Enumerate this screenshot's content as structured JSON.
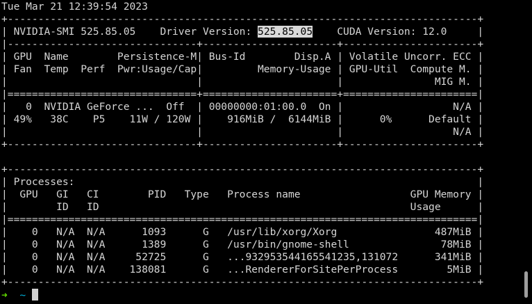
{
  "timestamp": "Tue Mar 21 12:39:54 2023",
  "header": {
    "border_top": "+-----------------------------------------------------------------------------+",
    "smi_version_text": "| NVIDIA-SMI 525.85.05    Driver Version: ",
    "driver_version": "525.85.05",
    "cuda_text": "    CUDA Version: 12.0     |",
    "border_mid": "|-------------------------------+----------------------+----------------------+",
    "col_row1": "| GPU  Name        Persistence-M| Bus-Id        Disp.A | Volatile Uncorr. ECC |",
    "col_row2": "| Fan  Temp  Perf  Pwr:Usage/Cap|         Memory-Usage | GPU-Util  Compute M. |",
    "col_row3": "|                               |                      |               MIG M. |",
    "border_double": "|===============================+======================+======================|"
  },
  "gpu": {
    "row1": "|   0  NVIDIA GeForce ...  Off  | 00000000:01:00.0  On |                  N/A |",
    "row2": "| 49%   38C    P5    11W / 120W |    916MiB /  6144MiB |      0%      Default |",
    "row3": "|                               |                      |                  N/A |",
    "border_bottom": "+-------------------------------+----------------------+----------------------+"
  },
  "processes": {
    "border_top": "+-----------------------------------------------------------------------------+",
    "title_row": "| Processes:                                                                  |",
    "col_row1": "|  GPU   GI   CI        PID   Type   Process name                  GPU Memory |",
    "col_row2": "|        ID   ID                                                   Usage      |",
    "border_double": "|=============================================================================|",
    "rows": [
      "|    0   N/A  N/A      1093      G   /usr/lib/xorg/Xorg                487MiB |",
      "|    0   N/A  N/A      1389      G   /usr/bin/gnome-shell               78MiB |",
      "|    0   N/A  N/A     52725      G   ...932953544165541235,131072      341MiB |",
      "|    0   N/A  N/A    138081      G   ...RendererForSitePerProcess        5MiB |"
    ],
    "border_bottom": "+-----------------------------------------------------------------------------+"
  },
  "prompt": {
    "arrow": "➜",
    "dir": "~"
  },
  "colors": {
    "background": "#000000",
    "text": "#d6d6d6",
    "prompt_arrow": "#5fd700",
    "prompt_dir": "#00afd7"
  }
}
